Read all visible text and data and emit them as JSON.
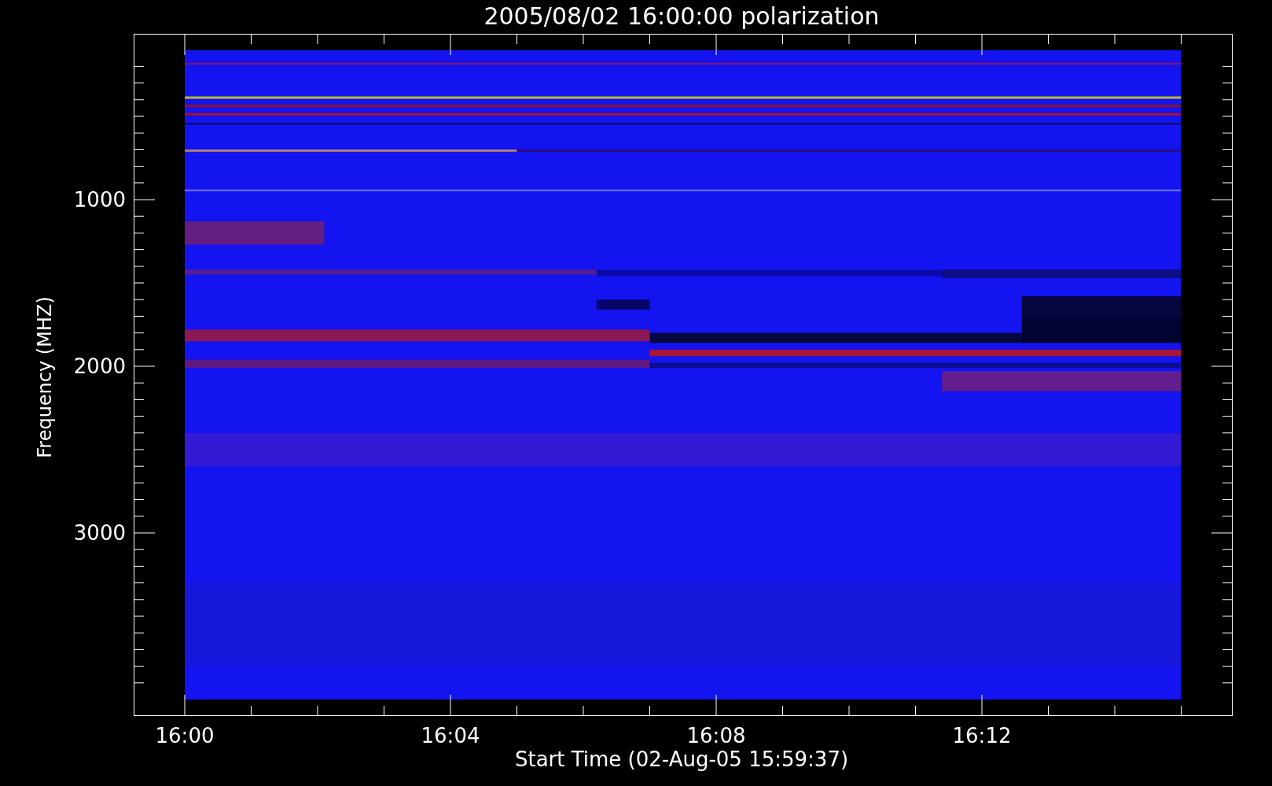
{
  "title": "2005/08/02 16:00:00 polarization",
  "ylabel": "Frequency (MHZ)",
  "xlabel": "Start Time (02-Aug-05 15:59:37)",
  "yticks": [
    "1000",
    "2000",
    "3000"
  ],
  "xticks": [
    "16:00",
    "16:04",
    "16:08",
    "16:12"
  ]
}
